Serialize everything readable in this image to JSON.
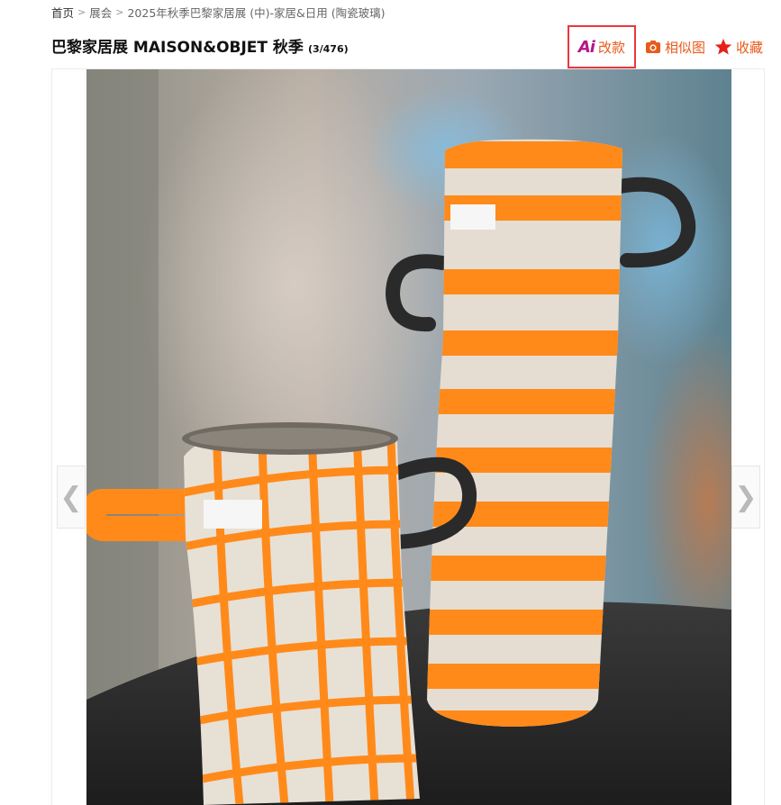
{
  "breadcrumb": {
    "home": "首页",
    "section": "展会",
    "current": "2025年秋季巴黎家居展 (中)-家居&日用 (陶瓷玻璃)",
    "separator": ">"
  },
  "title": {
    "main": "巴黎家居展 MAISON&OBJET 秋季",
    "count": "(3/476)"
  },
  "actions": {
    "ai_glyph": "Ai",
    "ai_label": "改款",
    "similar_label": "相似图",
    "favorite_label": "收藏"
  },
  "icons": {
    "ai": "ai-icon",
    "similar": "camera-icon",
    "favorite": "star-icon",
    "prev": "chevron-left-icon",
    "next": "chevron-right-icon"
  },
  "nav": {
    "prev": "❮",
    "next": "❯"
  },
  "colors": {
    "accent": "#e85a1a",
    "highlight_border": "#e8383d",
    "ai_magenta": "#b5178a",
    "vase_orange": "#ff8a1a"
  }
}
